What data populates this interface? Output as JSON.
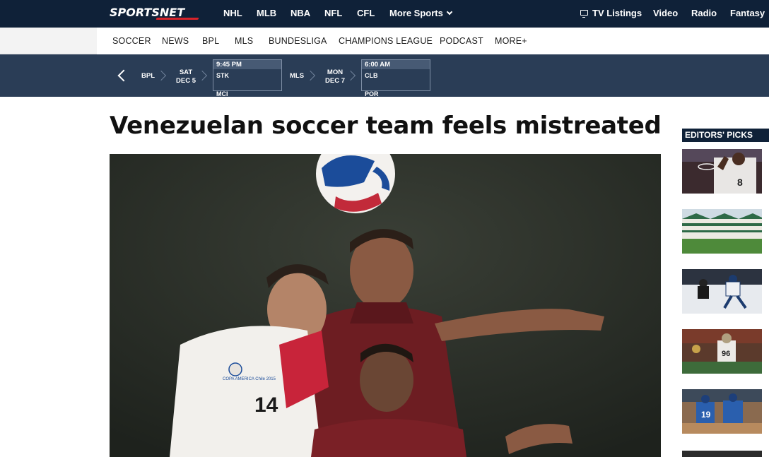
{
  "brand": {
    "logo_text": "SPORTSNET",
    "accent": "#d8232a",
    "nav_bg": "#0f2138",
    "scores_bg": "#2a3d56"
  },
  "topnav": {
    "links": [
      "NHL",
      "MLB",
      "NBA",
      "NFL",
      "CFL",
      "More Sports"
    ],
    "right": {
      "tv": "TV Listings",
      "video": "Video",
      "radio": "Radio",
      "fantasy": "Fantasy"
    },
    "icons": {
      "more_sports": "chevron-down-icon",
      "tv": "tv-icon"
    }
  },
  "subnav": {
    "links": [
      "SOCCER",
      "NEWS",
      "BPL",
      "MLS",
      "BUNDESLIGA",
      "CHAMPIONS LEAGUE",
      "PODCAST",
      "MORE+"
    ]
  },
  "scores": {
    "prev_icon": "chevron-left-icon",
    "groups": [
      {
        "league": "BPL",
        "day": "SAT",
        "date": "DEC 5",
        "time": "9:45 PM",
        "team1": "STK",
        "team2": "MCI"
      },
      {
        "league": "MLS",
        "day": "MON",
        "date": "DEC 7",
        "time": "6:00 AM",
        "team1": "CLB",
        "team2": "POR"
      }
    ]
  },
  "article": {
    "headline": "Venezuelan soccer team feels mistreated",
    "hero_jersey_number": "14",
    "hero_badge_text": "COPA AMERICA Chile 2015"
  },
  "sidebar": {
    "title": "EDITORS' PICKS",
    "thumb_jersey_number": "8",
    "thumb_scoreboard_number": "96",
    "thumb_jays_number": "19"
  }
}
